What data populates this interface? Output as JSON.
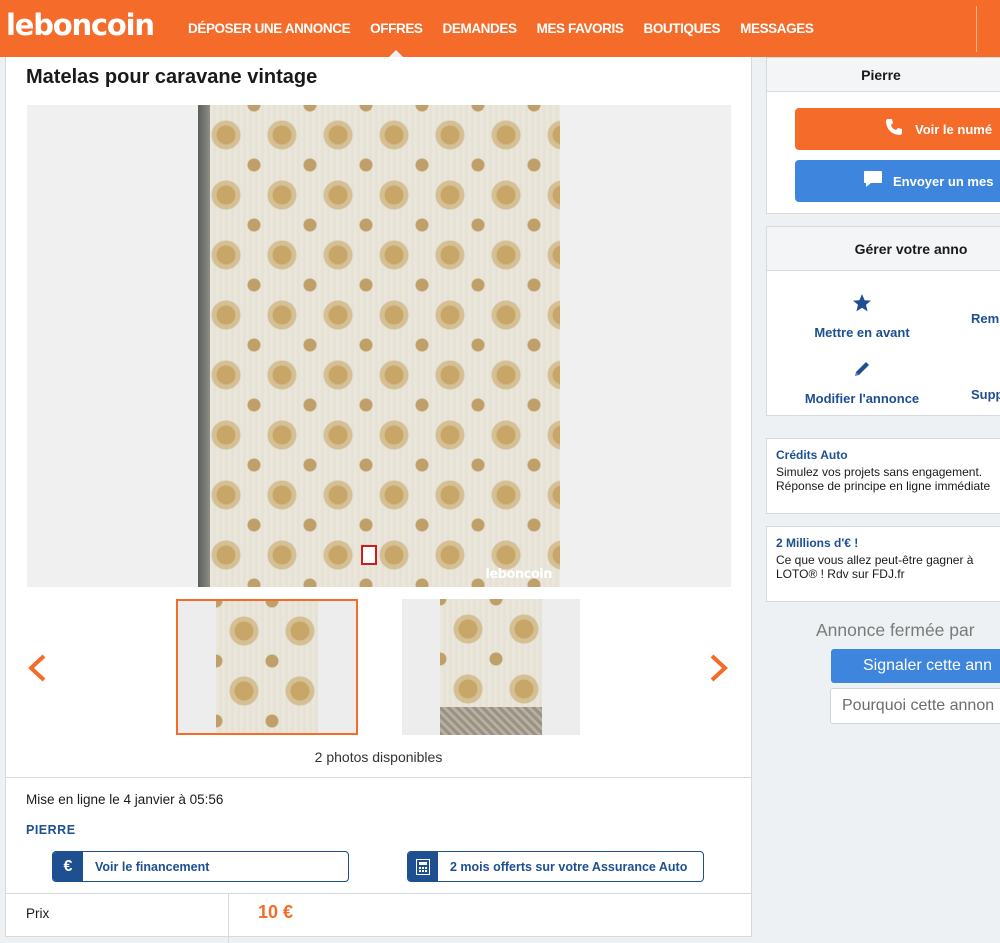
{
  "header": {
    "logo": "leboncoin",
    "nav": [
      "DÉPOSER UNE ANNONCE",
      "OFFRES",
      "DEMANDES",
      "MES FAVORIS",
      "BOUTIQUES",
      "MESSAGES"
    ],
    "active_nav": "OFFRES",
    "brand_color": "#f56b2a"
  },
  "listing": {
    "title": "Matelas pour caravane vintage",
    "watermark": "leboncoin",
    "photo_count": "2 photos disponibles",
    "posted": "Mise en ligne le 4 janvier à 05:56",
    "seller": "PIERRE",
    "financing_label": "Voir le financement",
    "insurance_label": "2 mois offerts sur votre Assurance Auto",
    "price_label": "Prix",
    "price_value": "10 €"
  },
  "sidebar": {
    "contact": {
      "name": "Pierre",
      "phone_button": "Voir le numé",
      "message_button": "Envoyer un mes"
    },
    "manage": {
      "title": "Gérer votre anno",
      "feature": "Mettre en avant",
      "bump": "Rem",
      "edit": "Modifier l'annonce",
      "delete": "Supp"
    },
    "promos": [
      {
        "title": "Crédits Auto",
        "line1": "Simulez vos projets sans engagement.",
        "line2": "Réponse de principe en ligne immédiate"
      },
      {
        "title": "2 Millions d'€ !",
        "line1": "Ce que vous allez peut-être gagner à",
        "line2": "LOTO® ! Rdv sur FDJ.fr"
      }
    ],
    "closed_text": "Annonce fermée par",
    "report_button": "Signaler cette ann",
    "why_placeholder": "Pourquoi cette annon"
  },
  "icons": [
    "chevron-left-icon",
    "chevron-right-icon",
    "euro-icon",
    "calculator-icon",
    "phone-icon",
    "chat-icon",
    "star-icon",
    "pencil-icon"
  ],
  "colors": {
    "orange": "#f56b2a",
    "blue": "#3e86dd",
    "navy": "#1d4f91"
  }
}
